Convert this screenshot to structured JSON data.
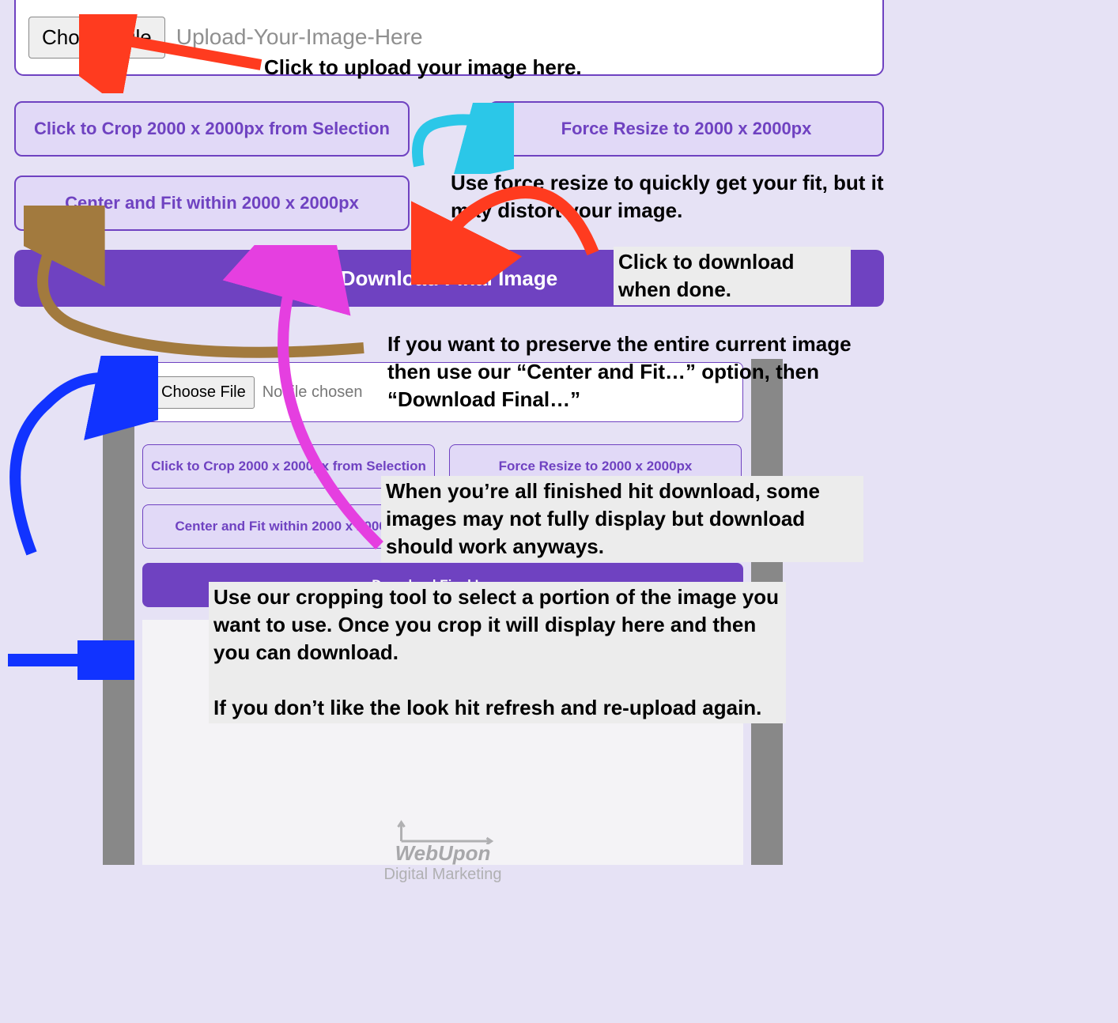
{
  "upload": {
    "choose_label": "Choose File",
    "placeholder": "Upload-Your-Image-Here"
  },
  "buttons": {
    "crop": "Click to Crop 2000 x 2000px from Selection",
    "force": "Force Resize to 2000 x 2000px",
    "center": "Center and Fit within 2000 x 2000px",
    "download": "Download Final Image"
  },
  "inner": {
    "choose_label": "Choose File",
    "placeholder": "No file chosen",
    "crop": "Click to Crop 2000 x 2000px from Selection",
    "force": "Force Resize to 2000 x 2000px",
    "center": "Center and Fit within 2000 x 2000px",
    "download": "Download Final Image",
    "logo_name": "WebUpon",
    "logo_sub": "Digital Marketing"
  },
  "captions": {
    "upload": "Click to upload your image here.",
    "force": "Use force resize to quickly get your fit, but it may distort your image.",
    "download": "Click to download when done.",
    "center": "If you want to preserve the entire current image then use our “Center and Fit…” option, then “Download Final…”",
    "finish": "When you’re all finished hit download, some images may not fully display but download should work anyways.",
    "crop": "Use our cropping tool to select a portion of the image you want to use. Once you crop it will display here and then you can download.\n\nIf you don’t like the look hit refresh and re-upload again."
  },
  "colors": {
    "purple": "#6f42c1",
    "lilac": "#e1d9f7",
    "arrow_red": "#ff3b1f",
    "arrow_cyan": "#2bc7e8",
    "arrow_brown": "#a27a3e",
    "arrow_magenta": "#e53fe0",
    "arrow_blue": "#1133ff"
  }
}
